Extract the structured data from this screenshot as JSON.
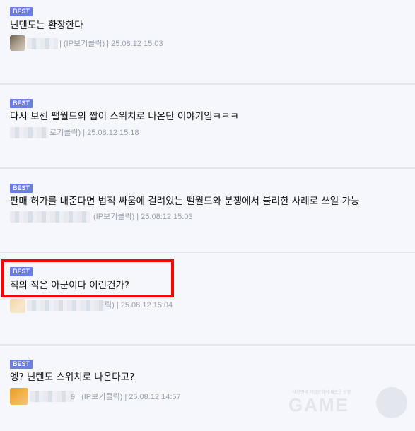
{
  "comments": [
    {
      "badge": "BEST",
      "title": "닌텐도는 환장한다",
      "meta": "| (IP보기클릭) | 25.08.12 15:03"
    },
    {
      "badge": "BEST",
      "title": "다시 보센 팰월드의 짭이 스위치로 나온단 이야기임ㅋㅋㅋ",
      "meta": "로기클릭) | 25.08.12 15:18"
    },
    {
      "badge": "BEST",
      "title": "판매 허가를 내준다면 법적 싸움에 걸려있는 펠월드와 분쟁에서 불리한 사례로 쓰일 가능",
      "meta": "(IP보기클릭) | 25.08.12 15:03"
    },
    {
      "badge": "BEST",
      "title": "적의 적은 아군이다 이런건가?",
      "meta": "릭) | 25.08.12 15:04"
    },
    {
      "badge": "BEST",
      "title": "엥? 닌텐도 스위치로  나온다고?",
      "meta": "9 | (IP보기클릭) | 25.08.12 14:57"
    }
  ],
  "watermark": {
    "subtitle": "대한민국 게임문화의 새로운 방향",
    "text": "GAME"
  },
  "colors": {
    "badge": "#6b7fe0",
    "highlight": "#ff0000",
    "background": "#f5f7fc"
  }
}
